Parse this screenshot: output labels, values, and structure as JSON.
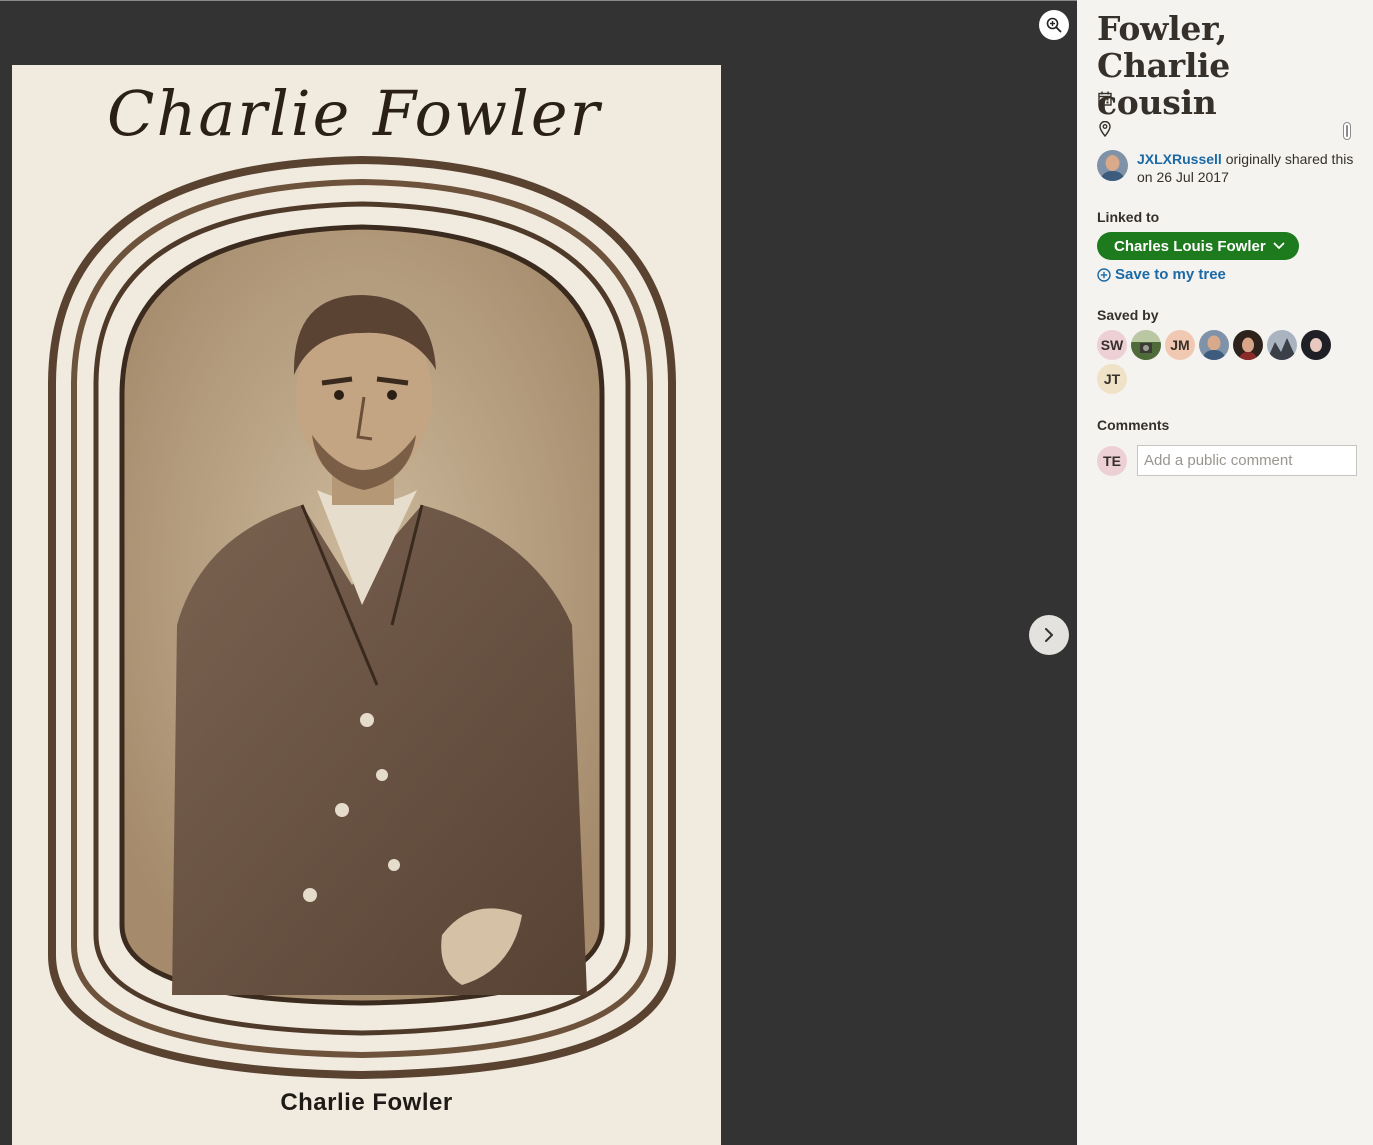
{
  "viewer": {
    "photo_signature": "Charlie Fowler",
    "photo_caption": "Charlie Fowler",
    "zoom_icon": "zoom-in-icon",
    "next_icon": "chevron-right-icon"
  },
  "panel": {
    "title": "Fowler, Charlie cousin",
    "date_icon": "calendar-icon",
    "location_icon": "location-pin-icon",
    "sharer": {
      "username": "JXLXRussell",
      "text": " originally shared this on 26 Jul 2017"
    },
    "linked_to": {
      "label": "Linked to",
      "person": "Charles Louis Fowler",
      "save_label": "Save to my tree"
    },
    "saved_by": {
      "label": "Saved by",
      "users": [
        {
          "initials": "SW",
          "color": "#ecd0d6"
        },
        {
          "initials": "",
          "color": "#5e6e48"
        },
        {
          "initials": "JM",
          "color": "#f1c9b3"
        },
        {
          "initials": "",
          "color": "#7d8fa3"
        },
        {
          "initials": "",
          "color": "#3a2a24"
        },
        {
          "initials": "",
          "color": "#4b5360"
        },
        {
          "initials": "",
          "color": "#1f1f26"
        },
        {
          "initials": "JT",
          "color": "#efe2c6"
        }
      ]
    },
    "comments": {
      "label": "Comments",
      "user_initials": "TE",
      "placeholder": "Add a public comment"
    }
  },
  "colors": {
    "link": "#1b6aa5",
    "pill": "#1d7a1d",
    "panel_bg": "#f5f3f0",
    "viewer_bg": "#333333"
  }
}
